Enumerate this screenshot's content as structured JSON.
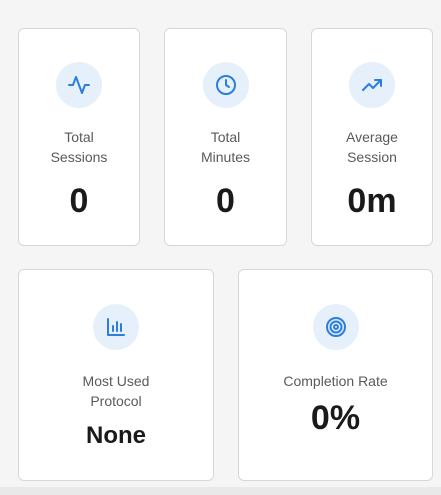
{
  "stats": {
    "total_sessions": {
      "label": "Total\nSessions",
      "value": "0",
      "icon": "activity-icon"
    },
    "total_minutes": {
      "label": "Total\nMinutes",
      "value": "0",
      "icon": "clock-icon"
    },
    "average_session": {
      "label": "Average\nSession",
      "value": "0m",
      "icon": "trending-up-icon"
    },
    "most_used_protocol": {
      "label": "Most Used\nProtocol",
      "value": "None",
      "icon": "bar-chart-icon"
    },
    "completion_rate": {
      "label": "Completion Rate",
      "value": "0%",
      "icon": "target-icon"
    }
  },
  "colors": {
    "accent": "#2b7de0",
    "icon_bg": "#e6f0fb",
    "card_bg": "#ffffff",
    "card_border": "#d7d7d7",
    "page_bg": "#f5f5f5",
    "value_text": "#1a1a1a",
    "label_text": "#5a5a5a"
  }
}
